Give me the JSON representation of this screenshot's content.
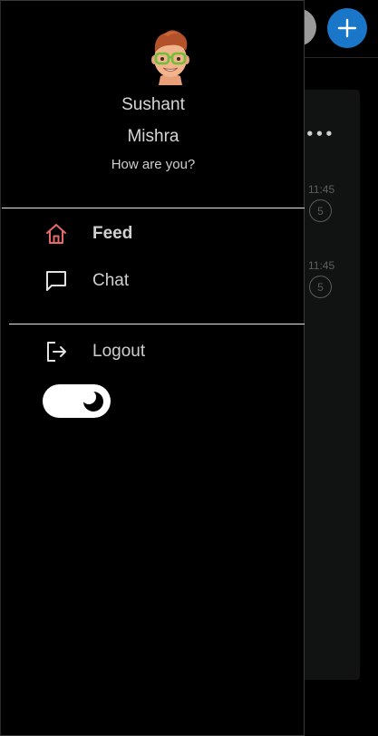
{
  "profile": {
    "first_name": "Sushant",
    "last_name": "Mishra",
    "status": "How are you?"
  },
  "menu": {
    "items": [
      {
        "label": "Feed",
        "icon": "home-icon",
        "active": true,
        "color": "#e46a6a"
      },
      {
        "label": "Chat",
        "icon": "chat-icon",
        "active": false
      }
    ],
    "logout_label": "Logout",
    "logout_icon": "logout-icon"
  },
  "theme_toggle": {
    "icon": "moon-icon",
    "mode": "dark"
  },
  "background": {
    "chats": [
      {
        "time": "11:45",
        "count": "5"
      },
      {
        "time": "11:45",
        "count": "5"
      }
    ],
    "add_icon": "plus-icon",
    "accent": "#1a76c9"
  }
}
